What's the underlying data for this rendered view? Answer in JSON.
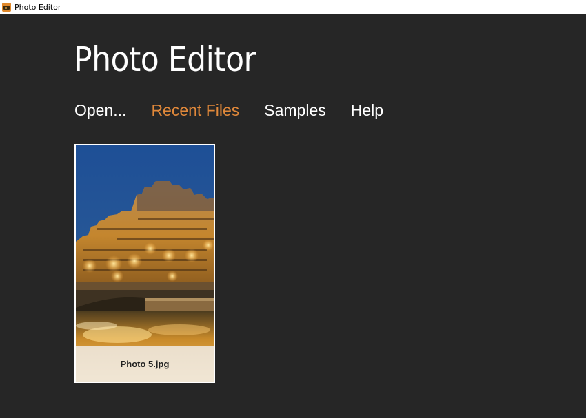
{
  "window": {
    "title": "Photo Editor",
    "icon": "photo-editor-app-icon"
  },
  "page": {
    "title": "Photo Editor"
  },
  "nav": {
    "items": [
      {
        "label": "Open..."
      },
      {
        "label": "Recent Files",
        "active": true
      },
      {
        "label": "Samples"
      },
      {
        "label": "Help"
      }
    ]
  },
  "recent_files": [
    {
      "name": "Photo 5.jpg",
      "thumbnail": "paris-night-buildings-bridge"
    }
  ],
  "colors": {
    "background": "#262626",
    "accent": "#e0883a",
    "text": "#ffffff",
    "titlebar": "#ffffff"
  }
}
